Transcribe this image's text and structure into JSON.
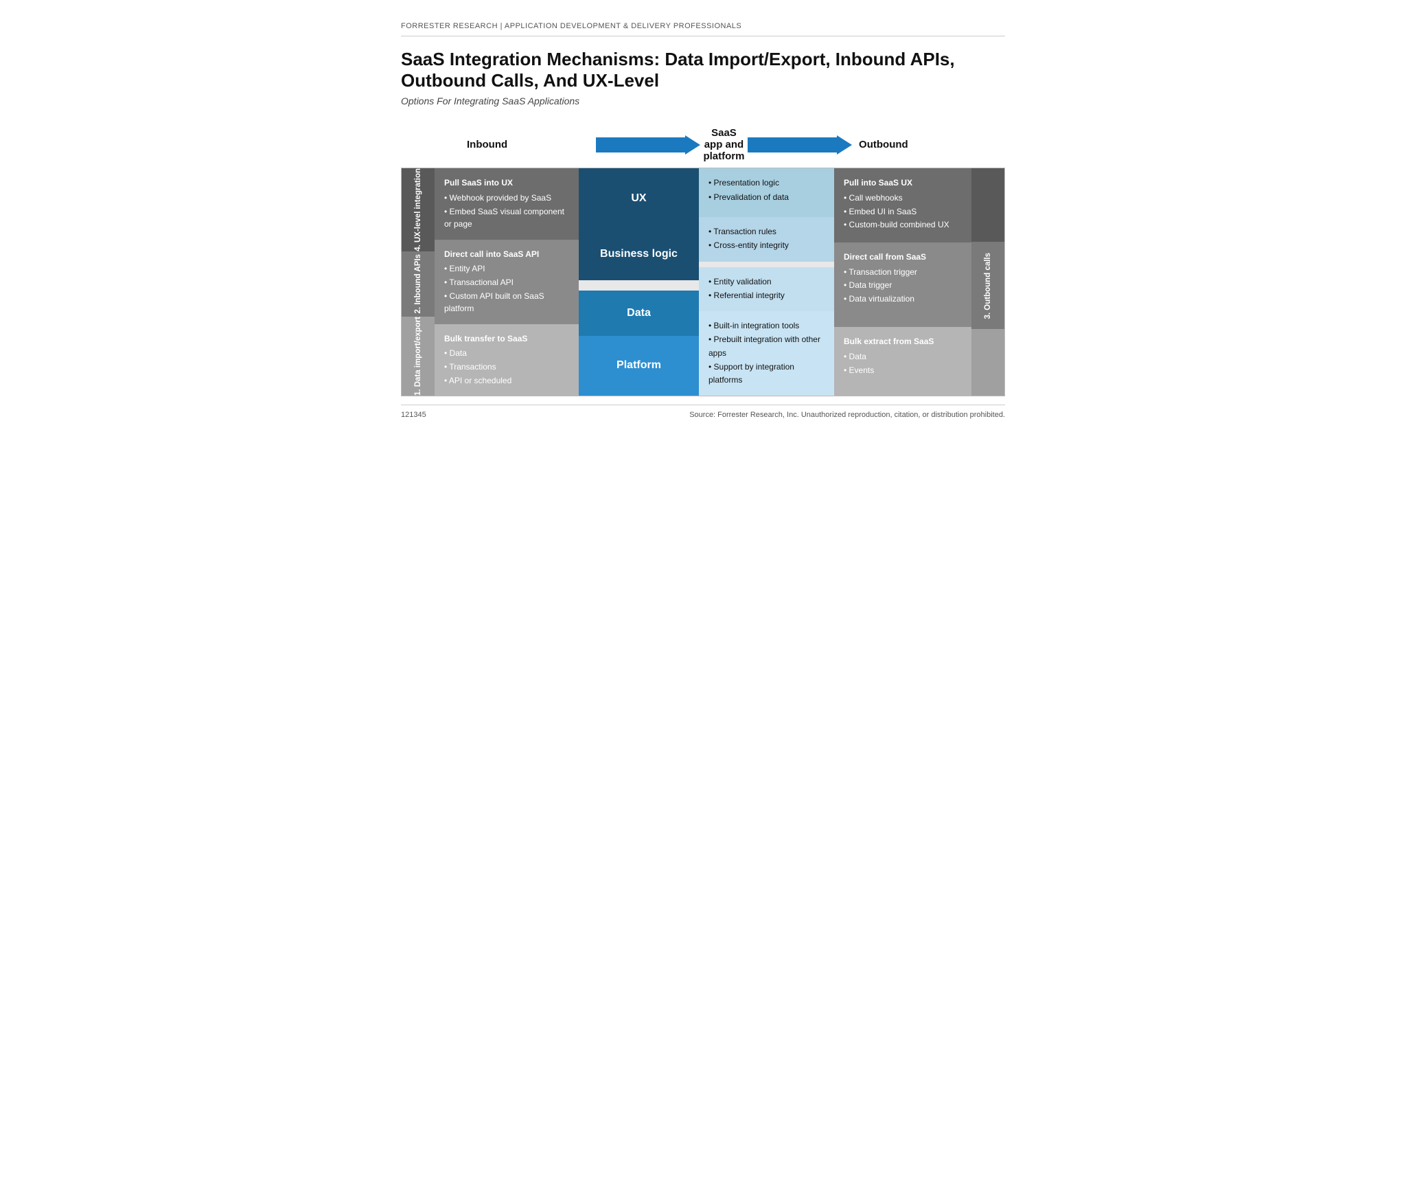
{
  "header": {
    "brand": "FORRESTER RESEARCH",
    "separator": "|",
    "category": "APPLICATION DEVELOPMENT & DELIVERY PROFESSIONALS"
  },
  "title": "SaaS Integration Mechanisms: Data Import/Export, Inbound APIs, Outbound Calls, And UX-Level",
  "subtitle": "Options For Integrating SaaS Applications",
  "arrows": {
    "inbound": "Inbound",
    "center": "SaaS app and platform",
    "outbound": "Outbound"
  },
  "sidebar_left": {
    "ux_label": "4. UX-level integration",
    "inbound_label": "2. Inbound APIs",
    "data_label": "1. Data import/export"
  },
  "sidebar_right": {
    "ux_label": "",
    "outbound_label": "3. Outbound calls",
    "data_label": ""
  },
  "inbound_col": {
    "ux": {
      "title": "Pull SaaS into UX",
      "bullets": [
        "Webhook provided by SaaS",
        "Embed SaaS visual component or page"
      ]
    },
    "apis": {
      "title": "Direct call into SaaS API",
      "bullets": [
        "Entity API",
        "Transactional API",
        "Custom API built on SaaS platform"
      ]
    },
    "data": {
      "title": "Bulk transfer to SaaS",
      "bullets": [
        "Data",
        "Transactions",
        "API or scheduled"
      ]
    }
  },
  "center_col": {
    "ux": "UX",
    "biz": "Business logic",
    "data": "Data",
    "platform": "Platform"
  },
  "desc_col": {
    "ux": {
      "bullets": [
        "Presentation logic",
        "Prevalidation of data"
      ]
    },
    "biz": {
      "bullets": [
        "Transaction rules",
        "Cross-entity integrity"
      ]
    },
    "data": {
      "bullets": [
        "Entity validation",
        "Referential integrity"
      ]
    },
    "platform": {
      "bullets": [
        "Built-in integration tools",
        "Prebuilt integration with other apps",
        "Support by integration platforms"
      ]
    }
  },
  "outbound_col": {
    "ux": {
      "title": "Pull into SaaS UX",
      "bullets": [
        "Call webhooks",
        "Embed UI in SaaS",
        "Custom-build combined UX"
      ]
    },
    "calls": {
      "title": "Direct call from SaaS",
      "bullets": [
        "Transaction trigger",
        "Data trigger",
        "Data virtualization"
      ]
    },
    "data": {
      "title": "Bulk extract from SaaS",
      "bullets": [
        "Data",
        "Events"
      ]
    }
  },
  "footer": {
    "doc_id": "121345",
    "source": "Source: Forrester Research, Inc. Unauthorized reproduction, citation, or distribution prohibited."
  }
}
